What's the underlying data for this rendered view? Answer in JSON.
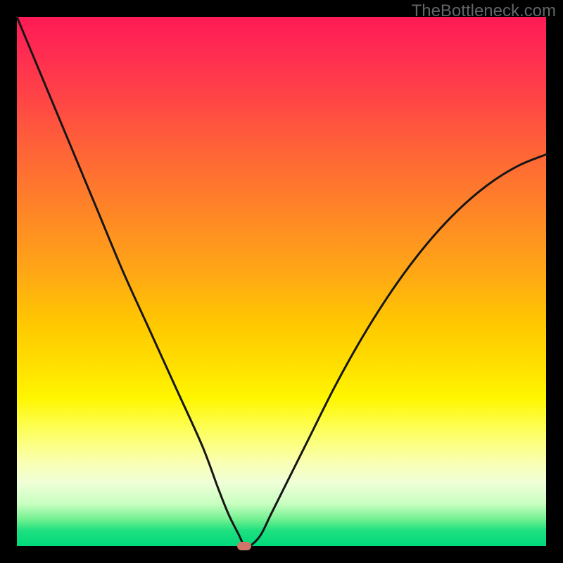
{
  "watermark": "TheBottleneck.com",
  "colors": {
    "frame": "#000000",
    "curve_stroke": "#161616",
    "marker": "#cf7569",
    "gradient_stops": [
      "#ff1a55",
      "#ff2a52",
      "#ff4048",
      "#ff6039",
      "#ff8328",
      "#ffa616",
      "#ffc800",
      "#ffe000",
      "#fff600",
      "#fdff5a",
      "#faffb0",
      "#f0ffd8",
      "#c8ffc0",
      "#70f090",
      "#20e080",
      "#00d87a"
    ]
  },
  "chart_data": {
    "type": "line",
    "title": "",
    "xlabel": "",
    "ylabel": "",
    "xlim": [
      0,
      100
    ],
    "ylim": [
      0,
      100
    ],
    "series": [
      {
        "name": "v-curve",
        "x": [
          0,
          5,
          10,
          15,
          20,
          25,
          30,
          35,
          38,
          40,
          42,
          43,
          44,
          46,
          48,
          50,
          55,
          60,
          65,
          70,
          75,
          80,
          85,
          90,
          95,
          100
        ],
        "values": [
          100,
          88,
          76,
          64,
          52,
          41,
          30,
          19,
          11,
          6,
          2,
          0,
          0,
          2,
          6,
          10,
          20,
          30,
          39,
          47,
          54,
          60,
          65,
          69,
          72,
          74
        ]
      }
    ],
    "marker": {
      "x": 43,
      "y": 0
    },
    "gradient_axis": "y",
    "gradient_meaning": "top=worst (red), bottom=best (green)"
  }
}
